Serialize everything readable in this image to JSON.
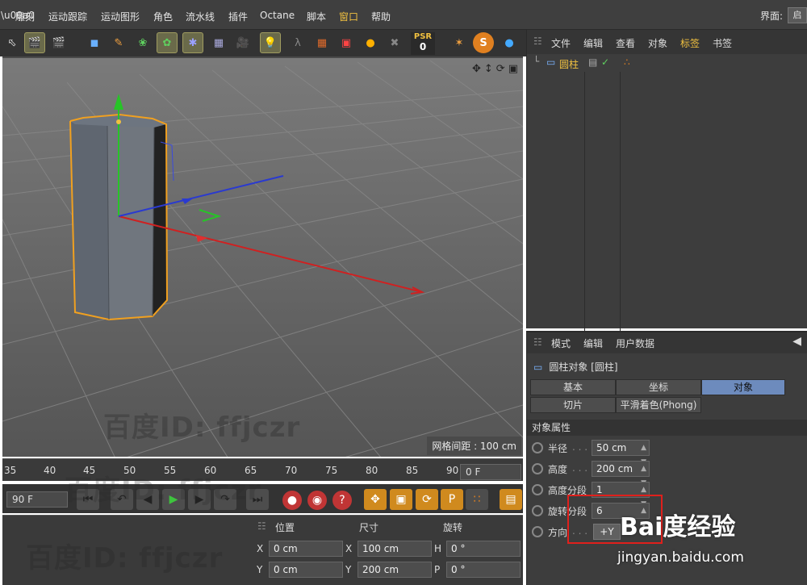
{
  "menubar": {
    "items": [
      "雕刻",
      "运动跟踪",
      "运动图形",
      "角色",
      "流水线",
      "插件",
      "Octane",
      "脚本",
      "窗口",
      "帮助"
    ],
    "interface_label": "界面:",
    "interface_value": "启"
  },
  "toolbar": {
    "psr_label": "PSR",
    "psr_value": "0"
  },
  "viewport": {
    "grid_spacing_label": "网格间距 : 100 cm"
  },
  "timeline": {
    "ticks": [
      "35",
      "40",
      "45",
      "50",
      "55",
      "60",
      "65",
      "70",
      "75",
      "80",
      "85",
      "90"
    ],
    "current_frame": "0 F",
    "end_frame": "90 F"
  },
  "coords": {
    "headers": {
      "position": "位置",
      "size": "尺寸",
      "rotation": "旋转"
    },
    "rows": [
      {
        "axis": "X",
        "position": "0 cm",
        "size_axis": "X",
        "size": "100 cm",
        "rot_axis": "H",
        "rotation": "0 °"
      },
      {
        "axis": "Y",
        "position": "0 cm",
        "size_axis": "Y",
        "size": "200 cm",
        "rot_axis": "P",
        "rotation": "0 °"
      }
    ]
  },
  "object_manager": {
    "menu": [
      "文件",
      "编辑",
      "查看",
      "对象",
      "标签",
      "书签"
    ],
    "object_name": "圆柱"
  },
  "attributes": {
    "menu": [
      "模式",
      "编辑",
      "用户数据"
    ],
    "title": "圆柱对象 [圆柱]",
    "tabs_row1": [
      "基本",
      "坐标",
      "对象"
    ],
    "tabs_row2": [
      "切片",
      "平滑着色(Phong)"
    ],
    "section": "对象属性",
    "props": [
      {
        "label": "半径",
        "value": "50 cm"
      },
      {
        "label": "高度",
        "value": "200 cm"
      },
      {
        "label": "高度分段",
        "value": "1"
      },
      {
        "label": "旋转分段",
        "value": "6"
      },
      {
        "label": "方向",
        "value": "+Y"
      }
    ]
  },
  "watermarks": {
    "id_text": "百度ID: ffjczr",
    "baidu_brand": "Bai度经验",
    "baidu_url": "jingyan.baidu.com"
  }
}
